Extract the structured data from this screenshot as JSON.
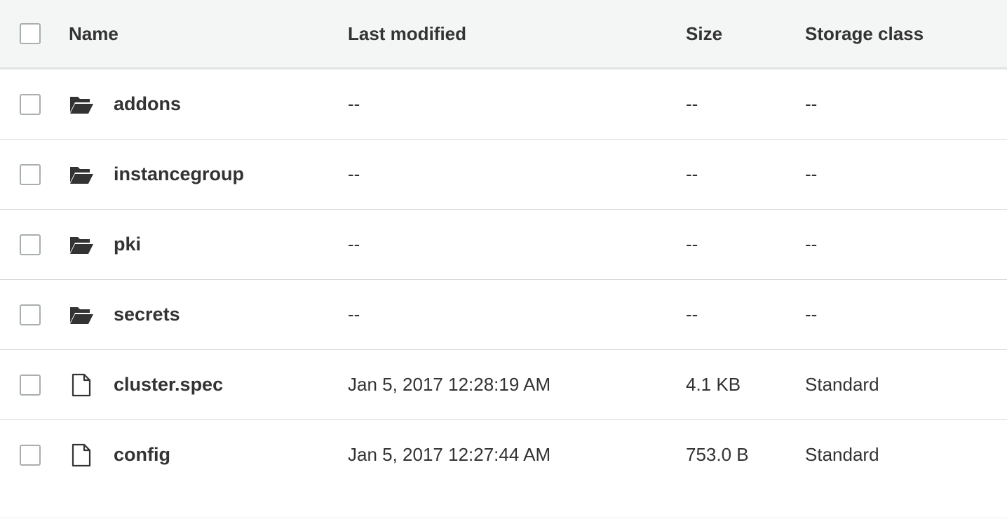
{
  "columns": {
    "name": "Name",
    "last_modified": "Last modified",
    "size": "Size",
    "storage_class": "Storage class"
  },
  "rows": [
    {
      "type": "folder",
      "icon": "folder-open-icon",
      "name": "addons",
      "last_modified": "--",
      "size": "--",
      "storage_class": "--"
    },
    {
      "type": "folder",
      "icon": "folder-open-icon",
      "name": "instancegroup",
      "last_modified": "--",
      "size": "--",
      "storage_class": "--"
    },
    {
      "type": "folder",
      "icon": "folder-open-icon",
      "name": "pki",
      "last_modified": "--",
      "size": "--",
      "storage_class": "--"
    },
    {
      "type": "folder",
      "icon": "folder-open-icon",
      "name": "secrets",
      "last_modified": "--",
      "size": "--",
      "storage_class": "--"
    },
    {
      "type": "file",
      "icon": "file-icon",
      "name": "cluster.spec",
      "last_modified": "Jan 5, 2017 12:28:19 AM",
      "size": "4.1 KB",
      "storage_class": "Standard"
    },
    {
      "type": "file",
      "icon": "file-icon",
      "name": "config",
      "last_modified": "Jan 5, 2017 12:27:44 AM",
      "size": "753.0 B",
      "storage_class": "Standard"
    }
  ]
}
